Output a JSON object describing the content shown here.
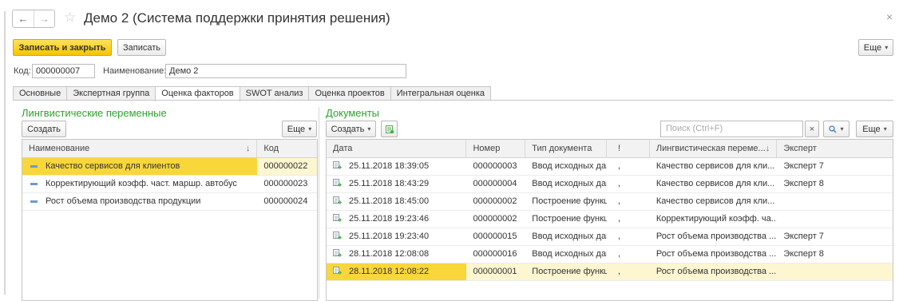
{
  "window": {
    "title": "Демо 2 (Система поддержки принятия решения)",
    "back_glyph": "←",
    "forward_glyph": "→",
    "star_glyph": "☆",
    "close_glyph": "×"
  },
  "toolbar": {
    "save_close_label": "Записать и закрыть",
    "save_label": "Записать",
    "more_label": "Еще"
  },
  "header_fields": {
    "code_label": "Код:",
    "code_value": "000000007",
    "name_label": "Наименование:",
    "name_value": "Демо 2"
  },
  "tabs": [
    {
      "label": "Основные",
      "active": false
    },
    {
      "label": "Экспертная группа",
      "active": false
    },
    {
      "label": "Оценка факторов",
      "active": true
    },
    {
      "label": "SWOT анализ",
      "active": false
    },
    {
      "label": "Оценка проектов",
      "active": false
    },
    {
      "label": "Интегральная оценка",
      "active": false
    }
  ],
  "left_panel": {
    "title": "Лингвистические переменные",
    "create_label": "Создать",
    "more_label": "Еще",
    "columns": {
      "name": "Наименование",
      "code": "Код",
      "sort_glyph": "↓"
    },
    "rows": [
      {
        "name": "Качество сервисов для клиентов",
        "code": "000000022",
        "selected": true
      },
      {
        "name": "Корректирующий коэфф. част. маршр. автобус",
        "code": "000000023",
        "selected": false
      },
      {
        "name": "Рост объема производства продукции",
        "code": "000000024",
        "selected": false
      }
    ]
  },
  "right_panel": {
    "title": "Документы",
    "create_label": "Создать",
    "search_placeholder": "Поиск (Ctrl+F)",
    "clear_glyph": "×",
    "search_icon_glyph": "🔍",
    "more_label": "Еще",
    "columns": {
      "date": "Дата",
      "number": "Номер",
      "doc_type": "Тип документа",
      "flag": "!",
      "ling_var": "Лингвистическая переме...",
      "sort_glyph": "↓",
      "expert": "Эксперт"
    },
    "rows": [
      {
        "date": "25.11.2018 18:39:05",
        "number": "000000003",
        "doc_type": "Ввод исходных дан...",
        "flag": ",",
        "ling_var": "Качество сервисов для кли...",
        "expert": "Эксперт 7",
        "selected": false
      },
      {
        "date": "25.11.2018 18:43:29",
        "number": "000000004",
        "doc_type": "Ввод исходных дан...",
        "flag": ",",
        "ling_var": "Качество сервисов для кли...",
        "expert": "Эксперт 8",
        "selected": false
      },
      {
        "date": "25.11.2018 18:45:00",
        "number": "000000002",
        "doc_type": "Построение функции...",
        "flag": ",",
        "ling_var": "Качество сервисов для кли...",
        "expert": "",
        "selected": false
      },
      {
        "date": "25.11.2018 19:23:46",
        "number": "000000002",
        "doc_type": "Построение функции...",
        "flag": ",",
        "ling_var": "Корректирующий коэфф. ча...",
        "expert": "",
        "selected": false
      },
      {
        "date": "25.11.2018 19:23:40",
        "number": "000000015",
        "doc_type": "Ввод исходных дан...",
        "flag": ",",
        "ling_var": "Рост объема производства ...",
        "expert": "Эксперт 7",
        "selected": false
      },
      {
        "date": "28.11.2018 12:08:08",
        "number": "000000016",
        "doc_type": "Ввод исходных дан...",
        "flag": ",",
        "ling_var": "Рост объема производства ...",
        "expert": "Эксперт 8",
        "selected": false
      },
      {
        "date": "28.11.2018 12:08:22",
        "number": "000000001",
        "doc_type": "Построение функции...",
        "flag": ",",
        "ling_var": "Рост объема производства ...",
        "expert": "",
        "selected": true
      }
    ]
  },
  "colors": {
    "accent_yellow": "#f5c400",
    "section_green": "#2ea22e",
    "selection_yellow": "#f9d63a",
    "selection_light": "#fdf6d0",
    "doc_icon_green": "#4caf50"
  }
}
